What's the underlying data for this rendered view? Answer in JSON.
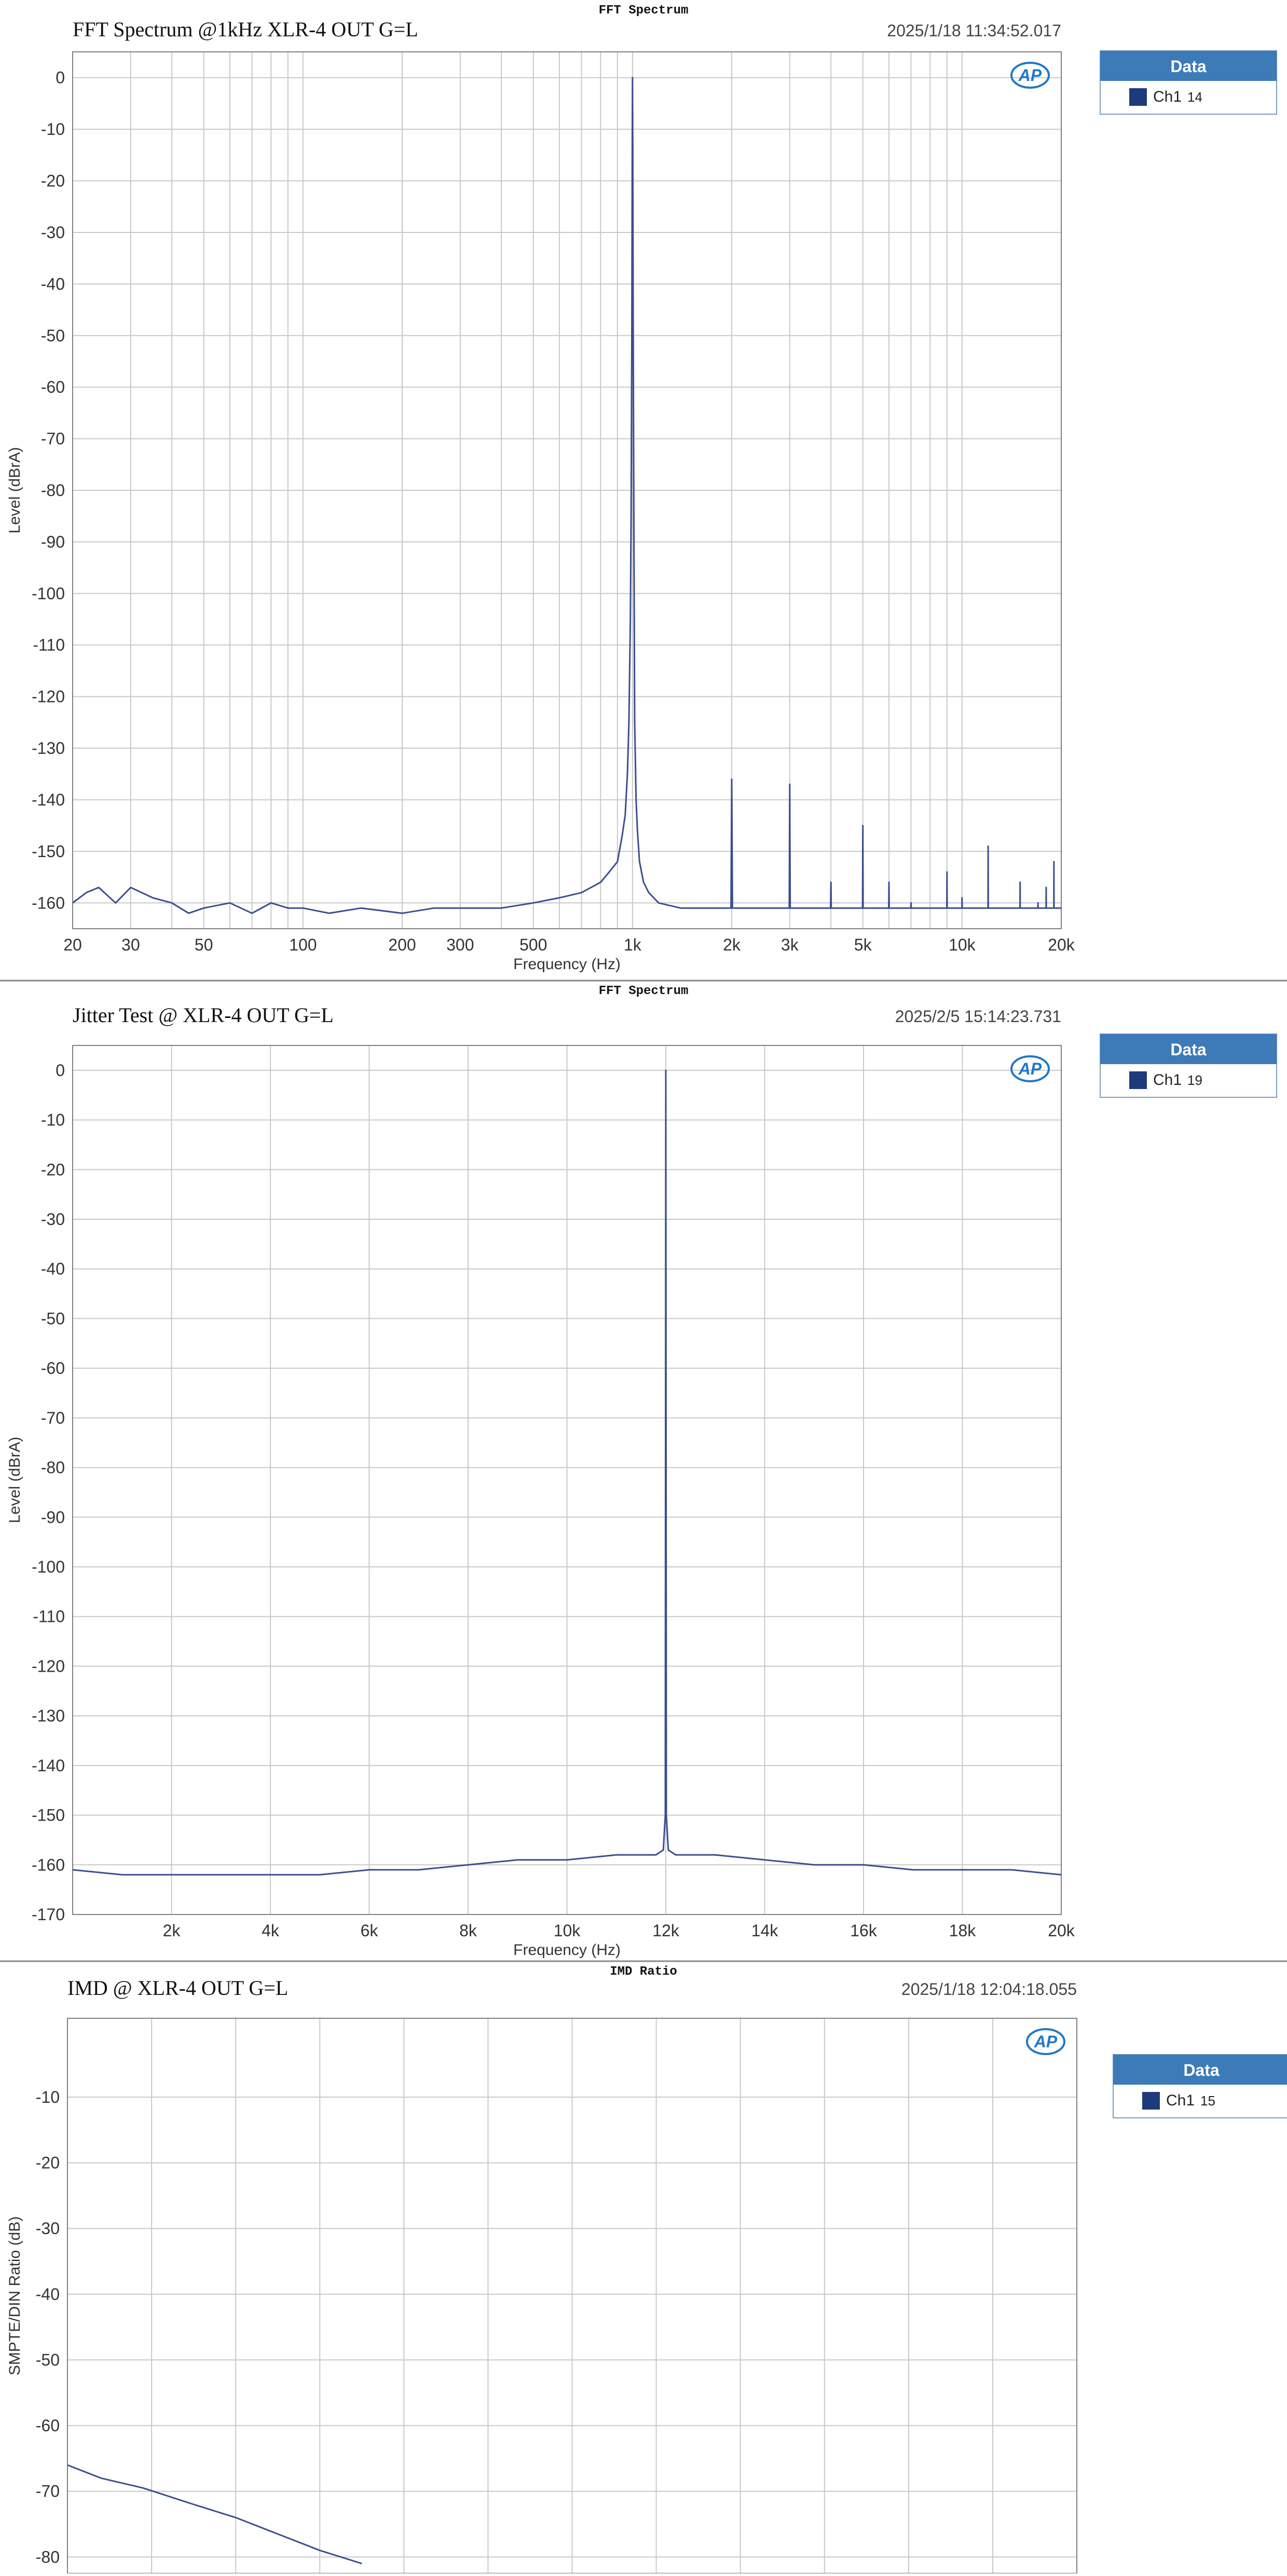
{
  "theme": {
    "series_color": "#3b4f8f",
    "legend_swatch": "#1f3a7a",
    "legend_header_bg": "#3d7ab8",
    "grid_color": "#c9c9c9",
    "logo_color": "#1f78c8"
  },
  "logo_text": "AP",
  "chart_data": [
    {
      "type": "line",
      "window_title": "FFT Spectrum",
      "title": "FFT Spectrum @1kHz XLR-4 OUT G=L",
      "timestamp": "2025/1/18 11:34:52.017",
      "xlabel": "Frequency (Hz)",
      "ylabel": "Level (dBrA)",
      "xscale": "log",
      "xlim": [
        20,
        20000
      ],
      "ylim": [
        -165,
        5
      ],
      "xticks": [
        20,
        30,
        50,
        100,
        200,
        300,
        500,
        1000,
        2000,
        3000,
        5000,
        10000,
        20000
      ],
      "xtick_labels": [
        "20",
        "30",
        "50",
        "100",
        "200",
        "300",
        "500",
        "1k",
        "2k",
        "3k",
        "5k",
        "10k",
        "20k"
      ],
      "yticks": [
        0,
        -10,
        -20,
        -30,
        -40,
        -50,
        -60,
        -70,
        -80,
        -90,
        -100,
        -110,
        -120,
        -130,
        -140,
        -150,
        -160
      ],
      "ytick_labels": [
        "0",
        "-10",
        "-20",
        "-30",
        "-40",
        "-50",
        "-60",
        "-70",
        "-80",
        "-90",
        "-100",
        "-110",
        "-120",
        "-130",
        "-140",
        "-150",
        "-160"
      ],
      "grid": true,
      "legend": {
        "position": "top-right",
        "header": "Data",
        "entries": [
          {
            "name": "Ch1",
            "value": "14"
          }
        ]
      },
      "series": [
        {
          "name": "Ch1",
          "x": [
            20,
            22,
            24,
            27,
            30,
            35,
            40,
            45,
            50,
            60,
            70,
            80,
            90,
            100,
            120,
            150,
            200,
            250,
            300,
            400,
            500,
            600,
            700,
            800,
            850,
            900,
            930,
            950,
            965,
            975,
            985,
            990,
            995,
            998,
            1000,
            1002,
            1005,
            1010,
            1015,
            1025,
            1035,
            1050,
            1080,
            1120,
            1200,
            1400,
            1700,
            1990,
            2000,
            2010,
            2200,
            2500,
            2990,
            3000,
            3010,
            3500,
            3990,
            4000,
            4010,
            4500,
            4990,
            5000,
            5010,
            5500,
            5990,
            6000,
            6010,
            6500,
            6990,
            7000,
            7010,
            8000,
            8500,
            8990,
            9000,
            9010,
            9500,
            9990,
            10000,
            10010,
            11000,
            11990,
            12000,
            12010,
            13000,
            14000,
            14990,
            15000,
            15010,
            15500,
            16000,
            16990,
            17000,
            17010,
            17500,
            17990,
            18000,
            18010,
            18500,
            18990,
            19000,
            19010,
            20000
          ],
          "y": [
            -160,
            -158,
            -157,
            -160,
            -157,
            -159,
            -160,
            -162,
            -161,
            -160,
            -162,
            -160,
            -161,
            -161,
            -162,
            -161,
            -162,
            -161,
            -161,
            -161,
            -160,
            -159,
            -158,
            -156,
            -154,
            -152,
            -147,
            -143,
            -135,
            -125,
            -105,
            -85,
            -50,
            -15,
            0,
            -15,
            -50,
            -90,
            -125,
            -140,
            -146,
            -152,
            -156,
            -158,
            -160,
            -161,
            -161,
            -161,
            -136,
            -161,
            -161,
            -161,
            -161,
            -137,
            -161,
            -161,
            -161,
            -156,
            -161,
            -161,
            -161,
            -145,
            -161,
            -161,
            -161,
            -156,
            -161,
            -161,
            -161,
            -160,
            -161,
            -161,
            -161,
            -161,
            -154,
            -161,
            -161,
            -161,
            -159,
            -161,
            -161,
            -161,
            -149,
            -161,
            -161,
            -161,
            -161,
            -156,
            -161,
            -161,
            -161,
            -161,
            -160,
            -161,
            -161,
            -161,
            -157,
            -161,
            -161,
            -161,
            -152,
            -161,
            -161
          ]
        }
      ]
    },
    {
      "type": "line",
      "window_title": "FFT Spectrum",
      "title": "Jitter Test @ XLR-4 OUT  G=L",
      "timestamp": "2025/2/5 15:14:23.731",
      "xlabel": "Frequency (Hz)",
      "ylabel": "Level (dBrA)",
      "xscale": "linear",
      "xlim": [
        0,
        20000
      ],
      "ylim": [
        -170,
        5
      ],
      "xticks": [
        2000,
        4000,
        6000,
        8000,
        10000,
        12000,
        14000,
        16000,
        18000,
        20000
      ],
      "xtick_labels": [
        "2k",
        "4k",
        "6k",
        "8k",
        "10k",
        "12k",
        "14k",
        "16k",
        "18k",
        "20k"
      ],
      "yticks": [
        0,
        -10,
        -20,
        -30,
        -40,
        -50,
        -60,
        -70,
        -80,
        -90,
        -100,
        -110,
        -120,
        -130,
        -140,
        -150,
        -160,
        -170
      ],
      "ytick_labels": [
        "0",
        "-10",
        "-20",
        "-30",
        "-40",
        "-50",
        "-60",
        "-70",
        "-80",
        "-90",
        "-100",
        "-110",
        "-120",
        "-130",
        "-140",
        "-150",
        "-160",
        "-170"
      ],
      "grid": true,
      "legend": {
        "position": "top-right",
        "header": "Data",
        "entries": [
          {
            "name": "Ch1",
            "value": "19"
          }
        ]
      },
      "series": [
        {
          "name": "Ch1",
          "x": [
            0,
            1000,
            2000,
            3000,
            4000,
            5000,
            6000,
            7000,
            8000,
            9000,
            10000,
            11000,
            11800,
            11950,
            11990,
            12000,
            12010,
            12050,
            12200,
            13000,
            14000,
            15000,
            16000,
            17000,
            18000,
            19000,
            20000
          ],
          "y": [
            -161,
            -162,
            -162,
            -162,
            -162,
            -162,
            -161,
            -161,
            -160,
            -159,
            -159,
            -158,
            -158,
            -157,
            -150,
            0,
            -150,
            -157,
            -158,
            -158,
            -159,
            -160,
            -160,
            -161,
            -161,
            -161,
            -162
          ]
        }
      ]
    },
    {
      "type": "line",
      "window_title": "IMD Ratio",
      "title": "IMD @ XLR-4 OUT G=L",
      "timestamp": "2025/1/18 12:04:18.055",
      "xlabel": "",
      "ylabel": "SMPTE/DIN Ratio (dB)",
      "xscale": "linear",
      "xlim": [
        0,
        12
      ],
      "ylim": [
        -82.5,
        2
      ],
      "yticks": [
        -10,
        -20,
        -30,
        -40,
        -50,
        -60,
        -70,
        -80
      ],
      "ytick_labels": [
        "-10",
        "-20",
        "-30",
        "-40",
        "-50",
        "-60",
        "-70",
        "-80"
      ],
      "grid": true,
      "legend": {
        "position": "top-right",
        "header": "Data",
        "entries": [
          {
            "name": "Ch1",
            "value": "15"
          }
        ]
      },
      "series": [
        {
          "name": "Ch1",
          "x": [
            0,
            0.4,
            0.9,
            1.5,
            2.0,
            2.5,
            3.0,
            3.5
          ],
          "y": [
            -66,
            -68,
            -69.5,
            -72,
            -74,
            -76.5,
            -79,
            -81
          ]
        }
      ]
    }
  ]
}
